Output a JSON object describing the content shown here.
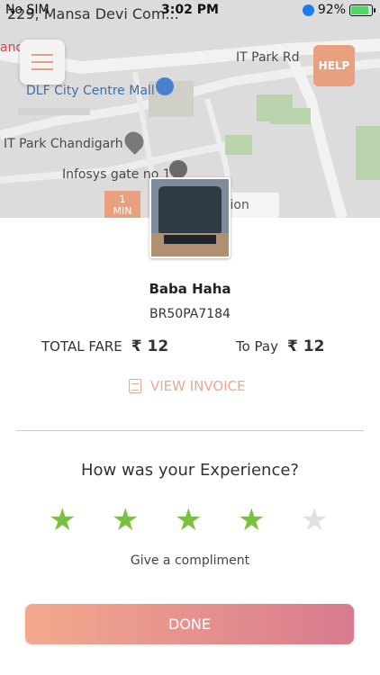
{
  "status_bar": {
    "carrier": "No SIM",
    "time": "3:02 PM",
    "battery": "92%"
  },
  "map": {
    "address": "229, Mansa Devi Com...",
    "labels": {
      "road": "IT Park Rd",
      "mall": "DLF City Centre Mall",
      "park": "IT Park Chandigarh",
      "gate": "Infosys gate no 1",
      "truncated_top": "andi",
      "destination": "tion"
    },
    "help_label": "HELP",
    "eta_value": "1",
    "eta_unit": "MIN"
  },
  "driver": {
    "name": "Baba Haha",
    "plate": "BR50PA7184"
  },
  "fare": {
    "total_label": "TOTAL FARE",
    "total_value": "₹ 12",
    "topay_label": "To Pay",
    "topay_value": "₹ 12"
  },
  "invoice_label": "VIEW INVOICE",
  "rating": {
    "question": "How was your Experience?",
    "value": 4,
    "max": 5,
    "compliment_label": "Give a compliment"
  },
  "done_label": "DONE",
  "colors": {
    "accent": "#e9a07f",
    "star_on": "#7ac142",
    "star_off": "#e0e0e0",
    "button_start": "#f4a98d",
    "button_end": "#d87b8f"
  }
}
